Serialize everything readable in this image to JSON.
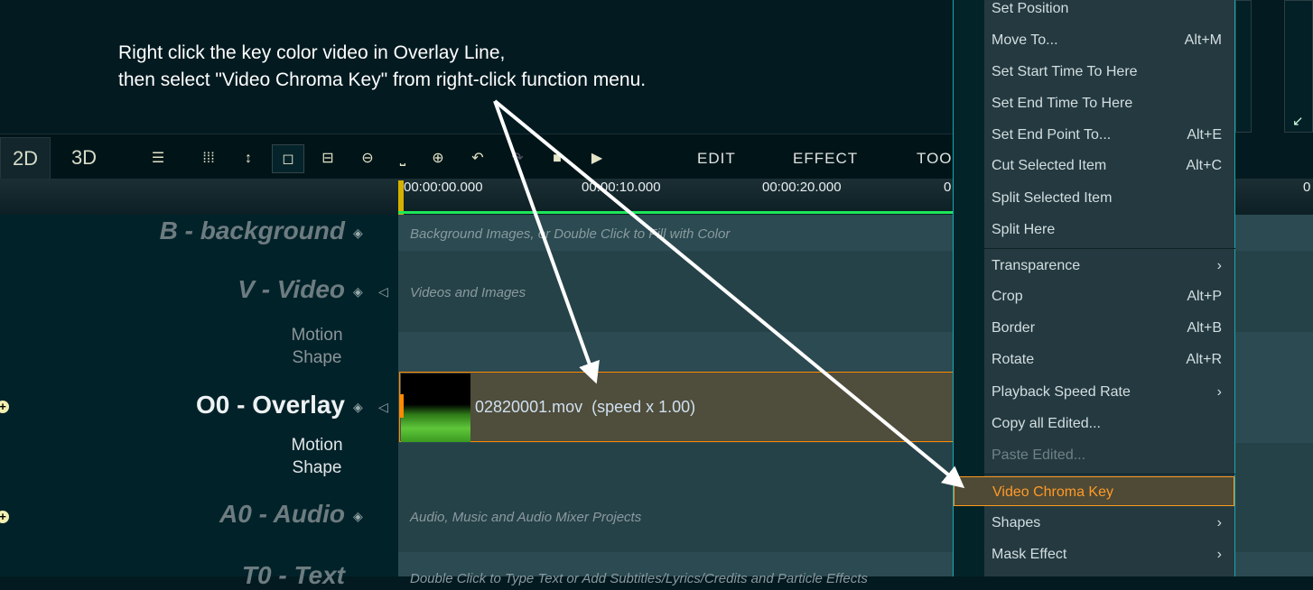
{
  "annotation": {
    "line1": "Right click the key color video in Overlay Line,",
    "line2": "then select \"Video Chroma Key\" from right-click function menu."
  },
  "toolbar": {
    "tab_2d": "2D",
    "tab_3d": "3D",
    "menu_edit": "EDIT",
    "menu_effect": "EFFECT",
    "menu_tools": "TOO",
    "icons": [
      "list-lines-icon",
      "grid-dots-icon",
      "vertical-resize-icon",
      "fit-view-icon",
      "split-box-icon",
      "zoom-out-icon",
      "ruler-icon",
      "zoom-in-icon",
      "undo-icon",
      "redo-icon",
      "stop-icon",
      "play-icon"
    ]
  },
  "ruler": {
    "times": [
      "00:00:00.000",
      "00:00:10.000",
      "00:00:20.000",
      "0",
      "0"
    ]
  },
  "tracks": {
    "background": {
      "label": "B - background",
      "hint": "Background Images, or Double Click to Fill with Color"
    },
    "video": {
      "label": "V - Video",
      "hint": "Videos and Images",
      "sub1": "Motion",
      "sub2": "Shape"
    },
    "overlay": {
      "label": "O0 - Overlay",
      "sub1": "Motion",
      "sub2": "Shape",
      "clip_name": "02820001.mov",
      "clip_speed": "(speed x 1.00)"
    },
    "audio": {
      "label": "A0 - Audio",
      "hint": "Audio, Music and Audio Mixer Projects"
    },
    "text": {
      "label": "T0 - Text",
      "hint": "Double Click to Type Text or Add Subtitles/Lyrics/Credits and Particle Effects"
    }
  },
  "context_menu": {
    "items": [
      {
        "label": "Set Position",
        "shortcut": ""
      },
      {
        "label": "Move  To...",
        "shortcut": "Alt+M"
      },
      {
        "label": "Set Start Time To Here",
        "shortcut": ""
      },
      {
        "label": "Set End Time To Here",
        "shortcut": ""
      },
      {
        "label": "Set End Point To...",
        "shortcut": "Alt+E"
      },
      {
        "label": "Cut Selected Item",
        "shortcut": "Alt+C"
      },
      {
        "label": "Split Selected Item",
        "shortcut": ""
      },
      {
        "label": "Split Here",
        "shortcut": ""
      },
      {
        "label": "Transparence",
        "shortcut": "›"
      },
      {
        "label": "Crop",
        "shortcut": "Alt+P"
      },
      {
        "label": "Border",
        "shortcut": "Alt+B"
      },
      {
        "label": "Rotate",
        "shortcut": "Alt+R"
      },
      {
        "label": "Playback Speed Rate",
        "shortcut": "›"
      },
      {
        "label": "Copy all Edited...",
        "shortcut": ""
      },
      {
        "label": "Paste Edited...",
        "shortcut": ""
      },
      {
        "label": "Video Chroma Key",
        "shortcut": ""
      },
      {
        "label": "Shapes",
        "shortcut": "›"
      },
      {
        "label": "Mask Effect",
        "shortcut": "›"
      }
    ]
  },
  "colors": {
    "accent": "#ff9a28",
    "playhead_bar": "#1ee65a",
    "menu_border": "#17a8b4"
  }
}
